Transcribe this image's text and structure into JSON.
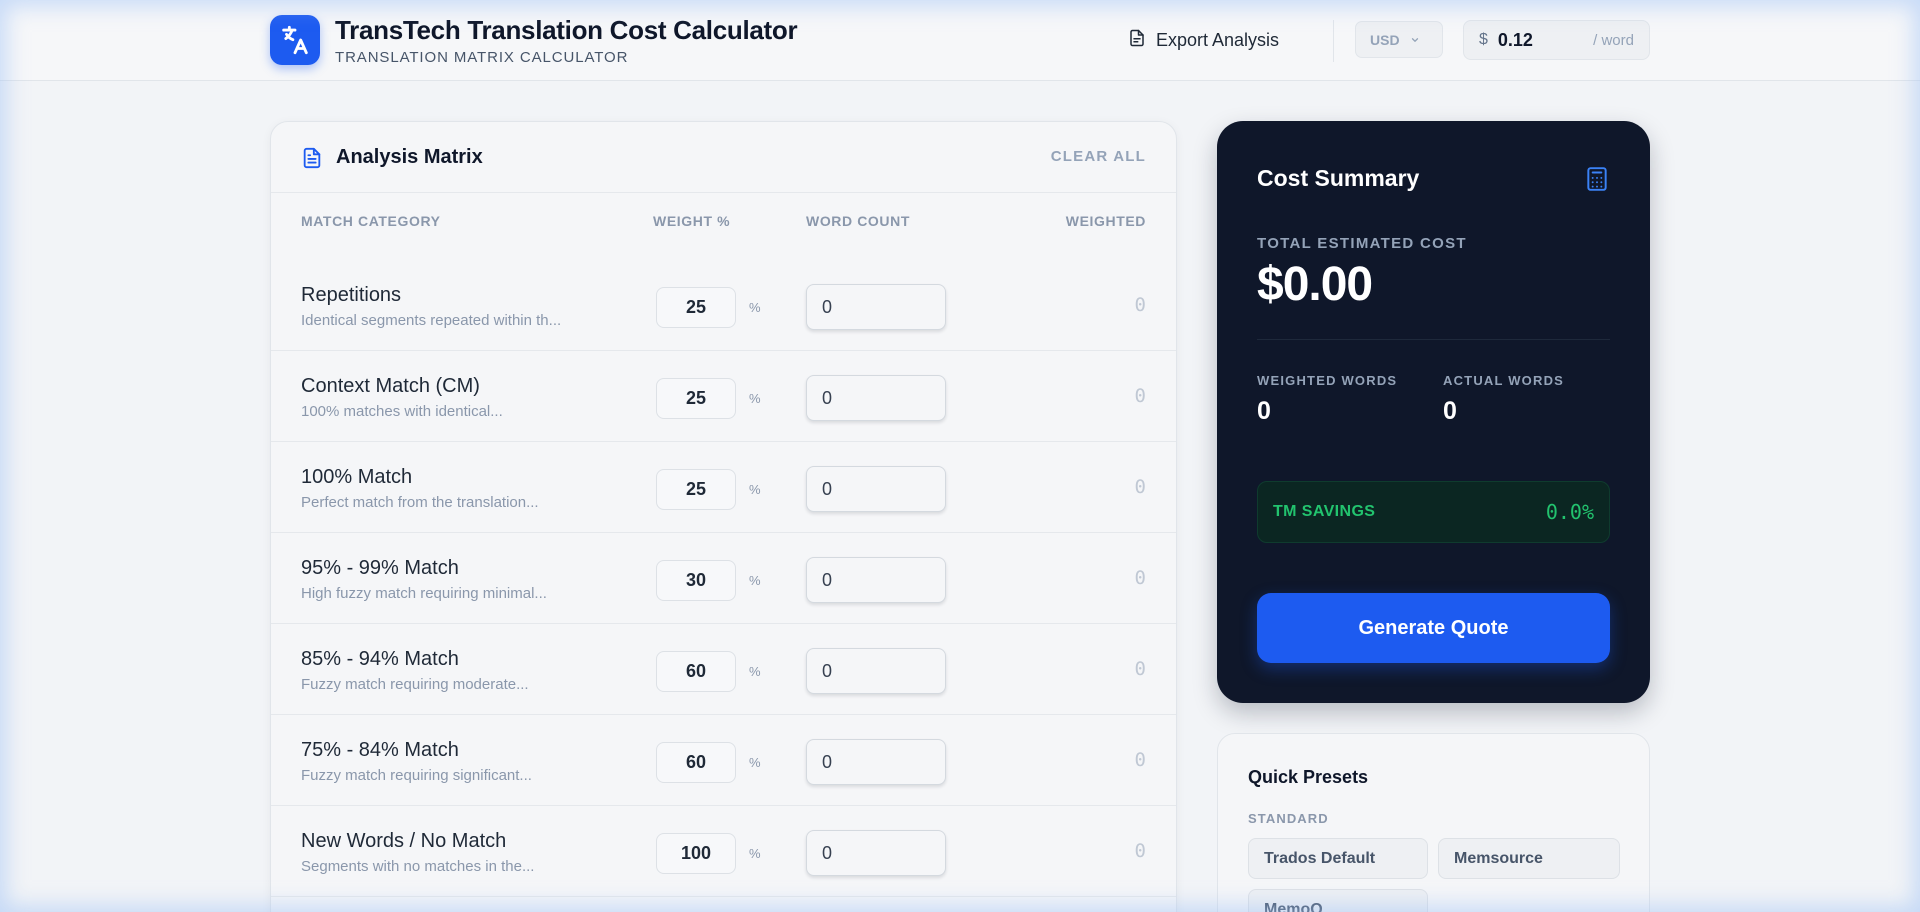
{
  "header": {
    "title": "TransTech Translation Cost Calculator",
    "subtitle": "TRANSLATION MATRIX CALCULATOR",
    "export_label": "Export Analysis",
    "currency": "USD",
    "rate_symbol": "$",
    "rate_value": "0.12",
    "rate_unit": "/ word"
  },
  "matrix": {
    "title": "Analysis Matrix",
    "clear_label": "CLEAR ALL",
    "columns": {
      "category": "MATCH CATEGORY",
      "weight": "WEIGHT %",
      "count": "WORD COUNT",
      "weighted": "WEIGHTED"
    },
    "percent_sign": "%",
    "rows": [
      {
        "name": "Repetitions",
        "desc": "Identical segments repeated within th...",
        "weight": "25",
        "count": "0",
        "weighted": "0"
      },
      {
        "name": "Context Match (CM)",
        "desc": "100% matches with identical...",
        "weight": "25",
        "count": "0",
        "weighted": "0"
      },
      {
        "name": "100% Match",
        "desc": "Perfect match from the translation...",
        "weight": "25",
        "count": "0",
        "weighted": "0"
      },
      {
        "name": "95% - 99% Match",
        "desc": "High fuzzy match requiring minimal...",
        "weight": "30",
        "count": "0",
        "weighted": "0"
      },
      {
        "name": "85% - 94% Match",
        "desc": "Fuzzy match requiring moderate...",
        "weight": "60",
        "count": "0",
        "weighted": "0"
      },
      {
        "name": "75% - 84% Match",
        "desc": "Fuzzy match requiring significant...",
        "weight": "60",
        "count": "0",
        "weighted": "0"
      },
      {
        "name": "New Words / No Match",
        "desc": "Segments with no matches in the...",
        "weight": "100",
        "count": "0",
        "weighted": "0"
      }
    ]
  },
  "summary": {
    "title": "Cost Summary",
    "total_label": "TOTAL ESTIMATED COST",
    "total_value": "$0.00",
    "weighted_label": "WEIGHTED WORDS",
    "weighted_value": "0",
    "actual_label": "ACTUAL WORDS",
    "actual_value": "0",
    "savings_label": "TM SAVINGS",
    "savings_value": "0.0%",
    "quote_button": "Generate Quote"
  },
  "presets": {
    "title": "Quick Presets",
    "category": "STANDARD",
    "items": [
      "Trados Default",
      "Memsource",
      "MemoQ"
    ]
  },
  "icons": {
    "logo": "translate-icon",
    "export": "document-icon",
    "currency_chevron": "chevron-down-icon",
    "matrix": "document-text-icon",
    "summary": "calculator-icon"
  },
  "colors": {
    "accent": "#1d5bf0",
    "summary_bg": "#0f172a",
    "savings_green": "#22c36e"
  }
}
